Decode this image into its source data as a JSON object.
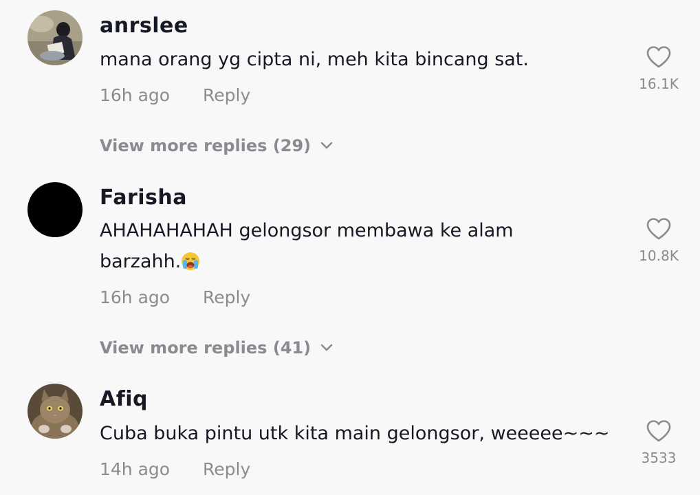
{
  "comments": [
    {
      "username": "anrslee",
      "text": "mana orang yg cipta ni, meh kita bincang sat.",
      "time": "16h ago",
      "reply_label": "Reply",
      "likes": "16.1K",
      "view_more": "View more replies (29)",
      "avatar": "photo-person-reading"
    },
    {
      "username": "Farisha",
      "text_line1": "AHAHAHAHAH gelongsor membawa ke alam",
      "text_line2": "barzahh.",
      "emoji": "loudly-crying-face",
      "time": "16h ago",
      "reply_label": "Reply",
      "likes": "10.8K",
      "view_more": "View more replies (41)",
      "avatar": "black-circle"
    },
    {
      "username": "Afiq",
      "text": "Cuba buka pintu utk kita main gelongsor, weeeee~~~",
      "time": "14h ago",
      "reply_label": "Reply",
      "likes": "3533",
      "avatar": "photo-cat"
    }
  ],
  "colors": {
    "background": "#f8f8f8",
    "primary_text": "#161823",
    "secondary_text": "#8a8b91"
  }
}
